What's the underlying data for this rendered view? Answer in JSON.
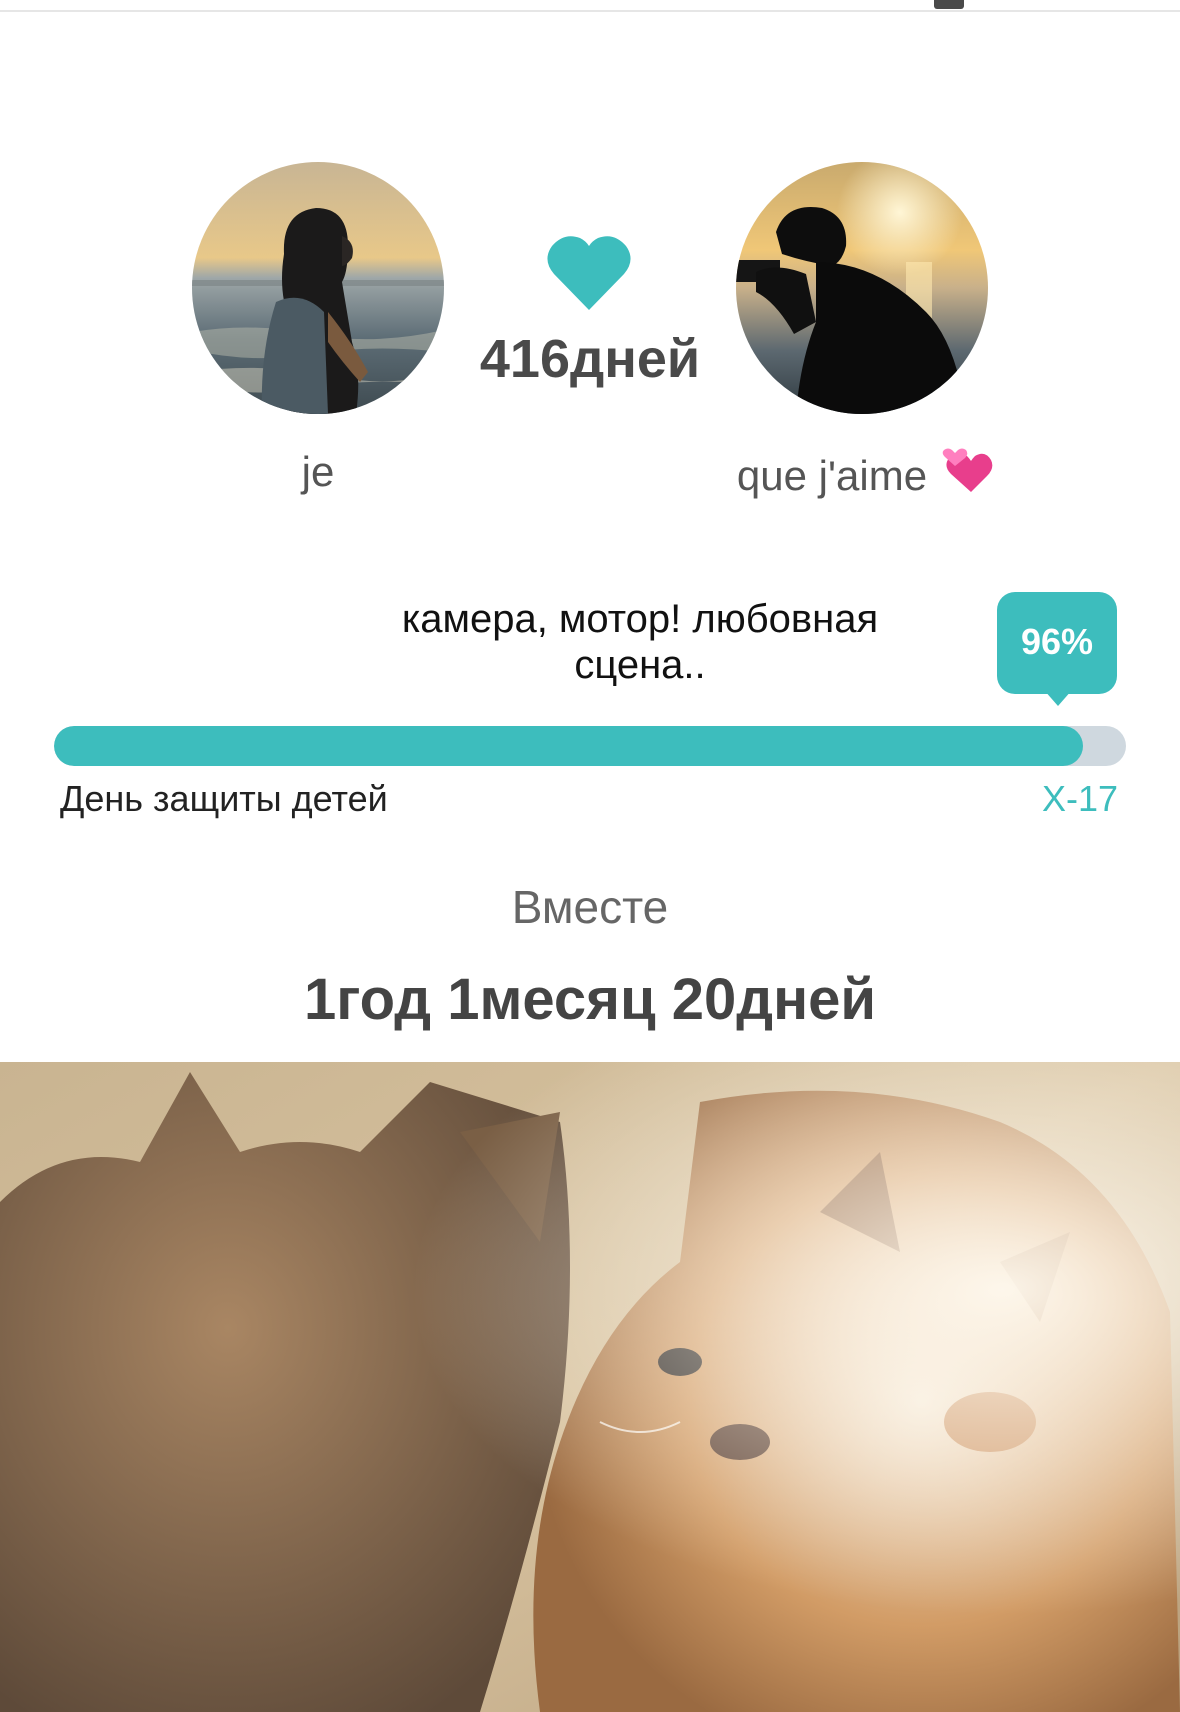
{
  "couple": {
    "days_count": "416дней",
    "me": {
      "name": "je",
      "avatar": "silhouette-girl-sunset"
    },
    "partner": {
      "name": "que j'aime",
      "emoji": "two-hearts-emoji",
      "avatar": "silhouette-photographer-sunset"
    },
    "heart_icon": "heart-icon"
  },
  "milestone": {
    "title": "камера, мотор! любовная сцена..",
    "progress_percent": 96,
    "progress_label": "96%",
    "event_name": "День защиты детей",
    "d_day": "Х-17"
  },
  "together": {
    "label": "Вместе",
    "duration": "1год 1месяц 20дней"
  },
  "cover": {
    "image": "two-cats-photo"
  },
  "colors": {
    "accent": "#3dbdbd",
    "track": "#cfd8df",
    "text_dark": "#444444"
  }
}
